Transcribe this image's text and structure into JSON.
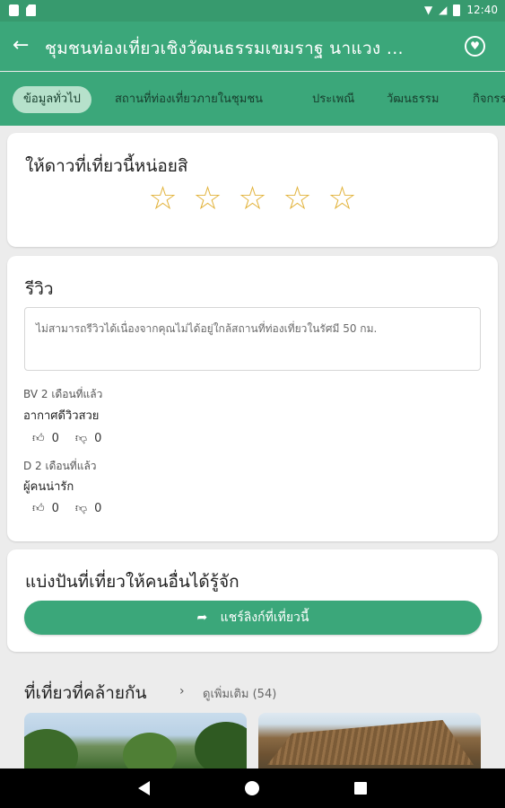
{
  "status": {
    "time": "12:40"
  },
  "appbar": {
    "title": "ชุมชนท่องเที่ยวเชิงวัฒนธรรมเขมราฐ นาแวง ..."
  },
  "tabs": [
    {
      "label": "ข้อมูลทั่วไป"
    },
    {
      "label": "สถานที่ท่องเที่ยวภายในชุมชน"
    },
    {
      "label": "ประเพณี"
    },
    {
      "label": "วัฒนธรรม"
    },
    {
      "label": "กิจกรรม"
    }
  ],
  "rating": {
    "title": "ให้ดาวที่เที่ยวนี้หน่อยสิ",
    "stars": 5,
    "filled": 0
  },
  "reviews": {
    "title": "รีวิว",
    "notice": "ไม่สามารถรีวิวได้เนื่องจากคุณไม่ได้อยู่ใกล้สถานที่ท่องเที่ยวในรัศมี 50 กม.",
    "items": [
      {
        "meta": "BV 2 เดือนที่แล้ว",
        "text": "อากาศดีวิวสวย",
        "likes": "0",
        "dislikes": "0"
      },
      {
        "meta": "D 2 เดือนที่แล้ว",
        "text": "ผู้คนน่ารัก",
        "likes": "0",
        "dislikes": "0"
      }
    ]
  },
  "share": {
    "title": "แบ่งปันที่เที่ยวให้คนอื่นได้รู้จัก",
    "button_label": "แชร์ลิงก์ที่เที่ยวนี้"
  },
  "similar": {
    "title": "ที่เที่ยวที่คล้ายกัน",
    "more_label": "ดูเพิ่มเติม (54)"
  },
  "colors": {
    "primary": "#3ba77a",
    "status_bar": "#379a6e",
    "tab_active": "#b6e1cb",
    "star": "#e2b33c"
  }
}
